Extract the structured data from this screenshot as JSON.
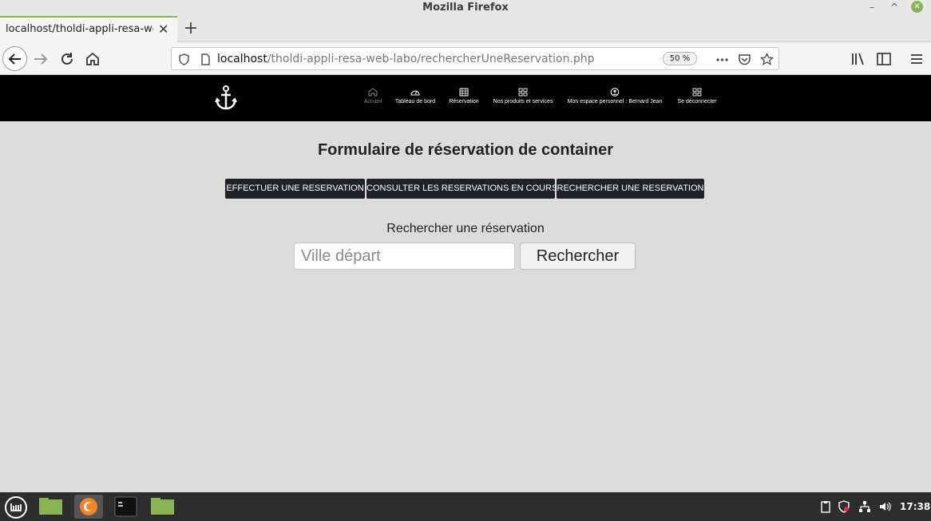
{
  "window": {
    "title": "Mozilla Firefox"
  },
  "browser": {
    "tab_label": "localhost/tholdi-appli-resa-web",
    "url_host": "localhost",
    "url_path": "/tholdi-appli-resa-web-labo/rechercherUneReservation.php",
    "zoom": "50 %"
  },
  "nav": {
    "items": [
      {
        "label": "Accueil",
        "icon": "home-icon"
      },
      {
        "label": "Tableau de bord",
        "icon": "speedometer-icon"
      },
      {
        "label": "Réservation",
        "icon": "table-icon"
      },
      {
        "label": "Nos produits et services",
        "icon": "grid-icon"
      },
      {
        "label": "Mon espace personnel : Bernard Jean",
        "icon": "user-circle-icon"
      },
      {
        "label": "Se déconnecter",
        "icon": "grid-icon"
      }
    ]
  },
  "page": {
    "title": "Formulaire de réservation de container",
    "buttons": [
      "EFFECTUER UNE RESERVATION",
      "CONSULTER LES RESERVATIONS EN COURS",
      "RECHERCHER UNE RESERVATION"
    ],
    "search_label": "Rechercher une réservation",
    "search_placeholder": "Ville départ",
    "search_button": "Rechercher"
  },
  "taskbar": {
    "clock": "17:38"
  },
  "colors": {
    "accent_green": "#8ab352",
    "header_bg": "#000000",
    "button_dark": "#1f2227",
    "page_bg": "#dcdcdc"
  }
}
